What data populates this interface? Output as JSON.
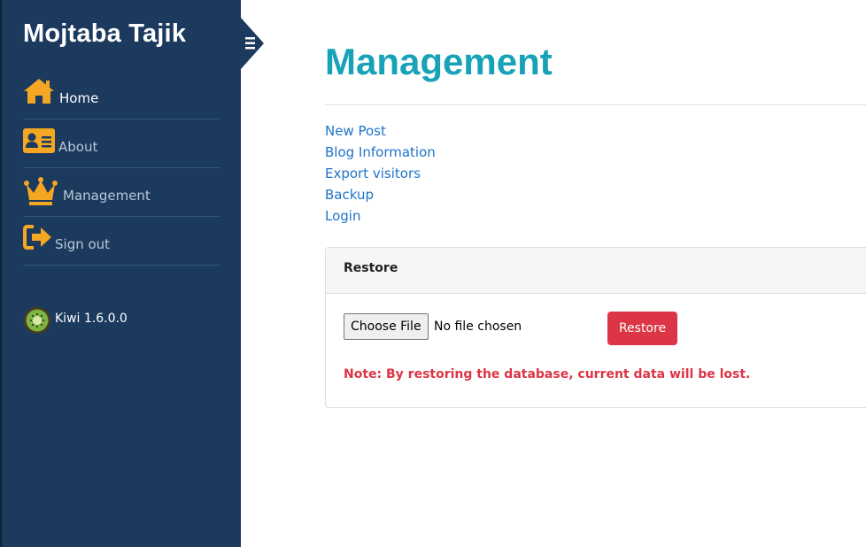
{
  "sidebar": {
    "brand": "Mojtaba Tajik",
    "toggle_icon": "bars-icon",
    "items": [
      {
        "label": "Home",
        "icon": "home-icon",
        "color": "#f5a623",
        "active": true
      },
      {
        "label": "About",
        "icon": "id-card-icon",
        "color": "#f5a623",
        "active": false
      },
      {
        "label": "Management",
        "icon": "crown-icon",
        "color": "#f5a623",
        "active": false
      },
      {
        "label": "Sign out",
        "icon": "sign-out-icon",
        "color": "#f5a623",
        "active": false
      }
    ],
    "version": {
      "label": "Kiwi 1.6.0.0",
      "icon": "kiwi-logo-icon"
    }
  },
  "main": {
    "title": "Management",
    "links": [
      "New Post",
      "Blog Information",
      "Export visitors",
      "Backup",
      "Login"
    ],
    "restore_card": {
      "header": "Restore",
      "choose_file_label": "Choose File",
      "file_status": "No file chosen",
      "restore_button": "Restore",
      "note": "Note: By restoring the database, current data will be lost."
    }
  },
  "colors": {
    "sidebar_bg": "#1c3a5e",
    "accent_title": "#17a2b8",
    "link": "#1f73c9",
    "danger": "#dc3545",
    "icon_orange": "#f5a623"
  }
}
